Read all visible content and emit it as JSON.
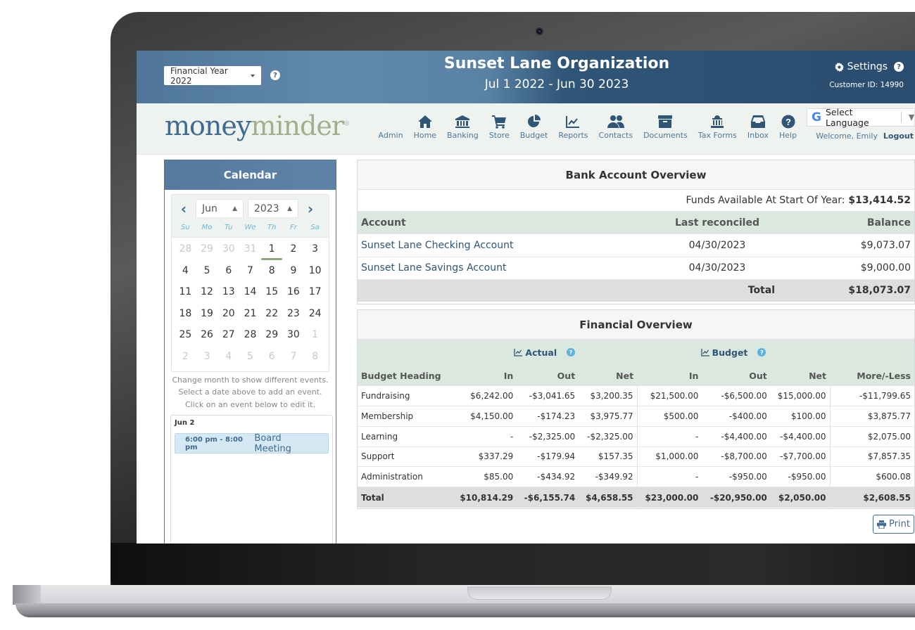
{
  "header": {
    "financial_year": "Financial Year 2022",
    "org_name": "Sunset Lane Organization",
    "period": "Jul 1 2022 - Jun 30 2023",
    "settings_label": "Settings",
    "customer_id": "Customer ID: 14990"
  },
  "logo": {
    "part1": "money",
    "part2": "minder",
    "mark": "®"
  },
  "nav": {
    "items": [
      {
        "label": "Admin",
        "icon": "none"
      },
      {
        "label": "Home",
        "icon": "home-icon"
      },
      {
        "label": "Banking",
        "icon": "bank-icon"
      },
      {
        "label": "Store",
        "icon": "cart-icon"
      },
      {
        "label": "Budget",
        "icon": "pie-chart-icon"
      },
      {
        "label": "Reports",
        "icon": "line-chart-icon"
      },
      {
        "label": "Contacts",
        "icon": "users-icon"
      },
      {
        "label": "Documents",
        "icon": "archive-icon"
      },
      {
        "label": "Tax Forms",
        "icon": "landmark-icon"
      },
      {
        "label": "Inbox",
        "icon": "inbox-icon"
      },
      {
        "label": "Help",
        "icon": "help-icon"
      }
    ],
    "language_label": "Select Language",
    "welcome": "Welcome, Emily",
    "logout": "Logout"
  },
  "calendar": {
    "title": "Calendar",
    "month": "Jun",
    "year": "2023",
    "weekdays": [
      "Su",
      "Mo",
      "Tu",
      "We",
      "Th",
      "Fr",
      "Sa"
    ],
    "days": [
      {
        "d": "28",
        "m": true
      },
      {
        "d": "29",
        "m": true
      },
      {
        "d": "30",
        "m": true
      },
      {
        "d": "31",
        "m": true
      },
      {
        "d": "1",
        "t": true
      },
      {
        "d": "2"
      },
      {
        "d": "3"
      },
      {
        "d": "4"
      },
      {
        "d": "5"
      },
      {
        "d": "6"
      },
      {
        "d": "7"
      },
      {
        "d": "8"
      },
      {
        "d": "9"
      },
      {
        "d": "10"
      },
      {
        "d": "11"
      },
      {
        "d": "12"
      },
      {
        "d": "13"
      },
      {
        "d": "14"
      },
      {
        "d": "15"
      },
      {
        "d": "16"
      },
      {
        "d": "17"
      },
      {
        "d": "18"
      },
      {
        "d": "19"
      },
      {
        "d": "20"
      },
      {
        "d": "21"
      },
      {
        "d": "22"
      },
      {
        "d": "23"
      },
      {
        "d": "24"
      },
      {
        "d": "25"
      },
      {
        "d": "26"
      },
      {
        "d": "27"
      },
      {
        "d": "28"
      },
      {
        "d": "29"
      },
      {
        "d": "30"
      },
      {
        "d": "1",
        "m": true
      },
      {
        "d": "2",
        "m": true
      },
      {
        "d": "3",
        "m": true
      },
      {
        "d": "4",
        "m": true
      },
      {
        "d": "5",
        "m": true
      },
      {
        "d": "6",
        "m": true
      },
      {
        "d": "7",
        "m": true
      },
      {
        "d": "8",
        "m": true
      }
    ],
    "hint": "Change month to show different events. Select a date above to add an event. Click on an event below to edit it.",
    "event_date": "Jun 2",
    "event_time": "6:00 pm - 8:00 pm",
    "event_title": "Board Meeting"
  },
  "bank": {
    "title": "Bank Account Overview",
    "funds_label": "Funds Available At Start Of Year:",
    "funds_value": "$13,414.52",
    "columns": [
      "Account",
      "Last reconciled",
      "Balance"
    ],
    "rows": [
      {
        "account": "Sunset Lane Checking Account",
        "reconciled": "04/30/2023",
        "balance": "$9,073.07"
      },
      {
        "account": "Sunset Lane Savings Account",
        "reconciled": "04/30/2023",
        "balance": "$9,000.00"
      }
    ],
    "total_label": "Total",
    "total_value": "$18,073.07"
  },
  "financial": {
    "title": "Financial Overview",
    "actual_label": "Actual",
    "budget_label": "Budget",
    "columns": [
      "Budget Heading",
      "In",
      "Out",
      "Net",
      "In",
      "Out",
      "Net",
      "More/-Less"
    ],
    "rows": [
      [
        "Fundraising",
        "$6,242.00",
        "-$3,041.65",
        "$3,200.35",
        "$21,500.00",
        "-$6,500.00",
        "$15,000.00",
        "-$11,799.65"
      ],
      [
        "Membership",
        "$4,150.00",
        "-$174.23",
        "$3,975.77",
        "$500.00",
        "-$400.00",
        "$100.00",
        "$3,875.77"
      ],
      [
        "Learning",
        "-",
        "-$2,325.00",
        "-$2,325.00",
        "-",
        "-$4,400.00",
        "-$4,400.00",
        "$2,075.00"
      ],
      [
        "Support",
        "$337.29",
        "-$179.94",
        "$157.35",
        "$1,000.00",
        "-$8,700.00",
        "-$7,700.00",
        "$7,857.35"
      ],
      [
        "Administration",
        "$85.00",
        "-$434.92",
        "-$349.92",
        "-",
        "-$950.00",
        "-$950.00",
        "$600.08"
      ]
    ],
    "total": [
      "Total",
      "$10,814.29",
      "-$6,155.74",
      "$4,658.55",
      "$23,000.00",
      "-$20,950.00",
      "$2,050.00",
      "$2,608.55"
    ],
    "print_label": "Print"
  }
}
